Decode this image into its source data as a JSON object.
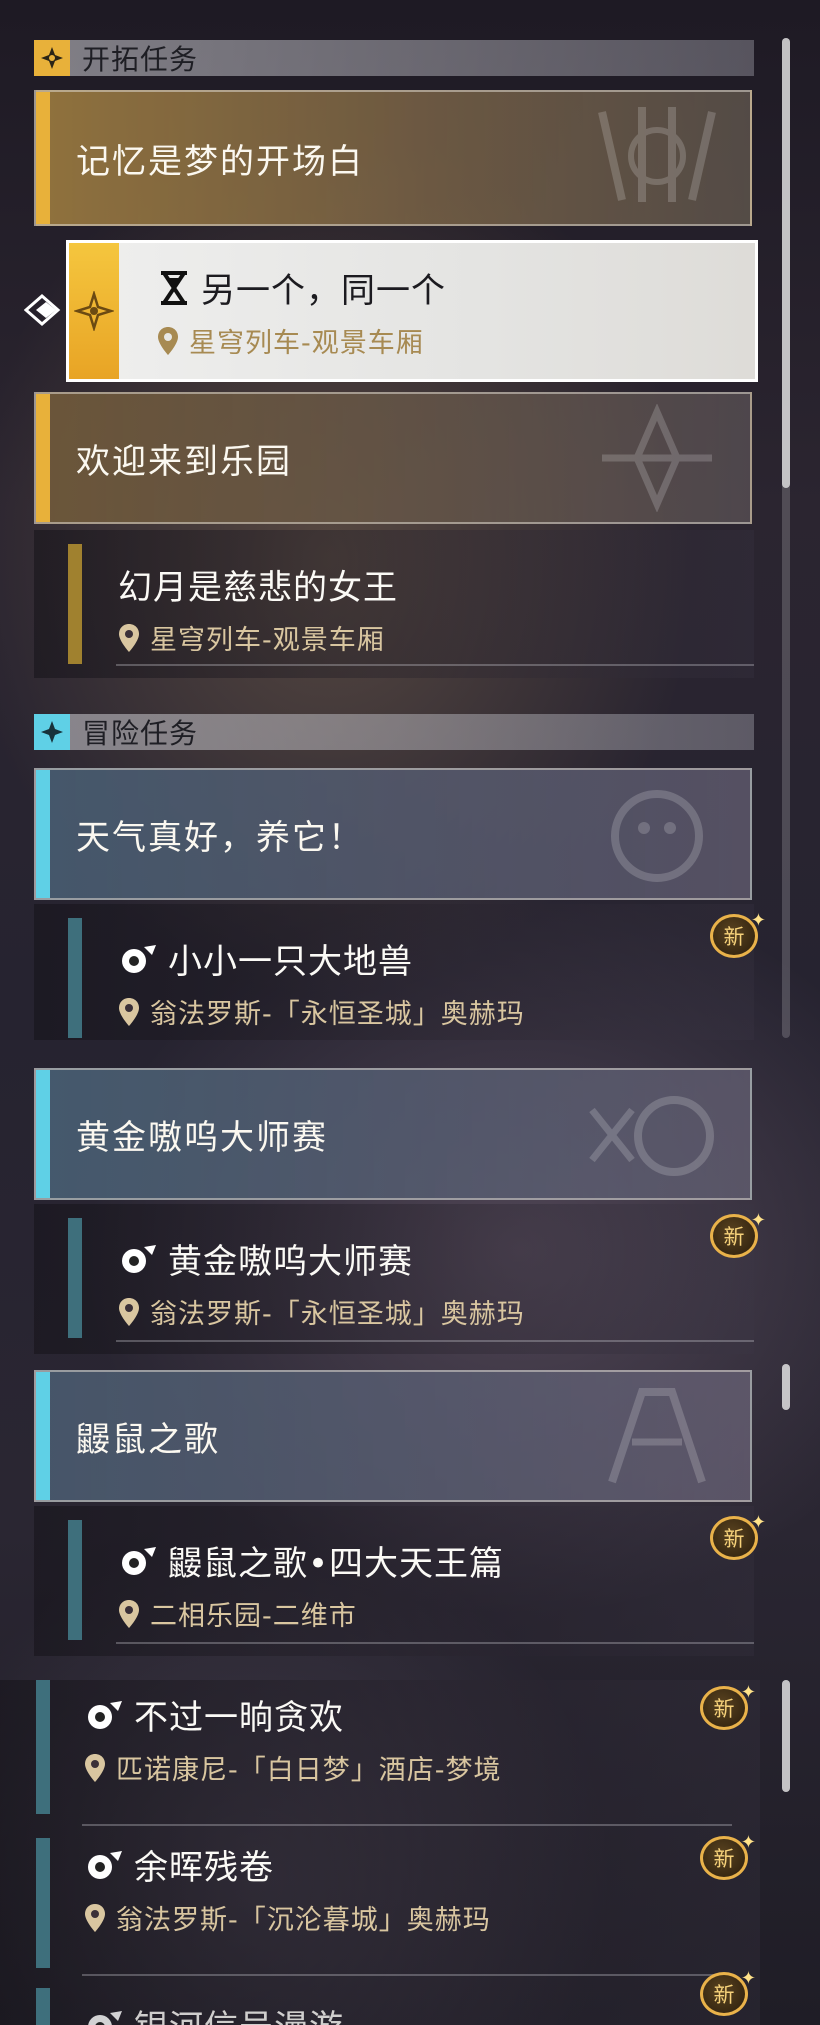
{
  "sections": {
    "trailblaze": {
      "title": "开拓任务"
    },
    "adventure": {
      "title": "冒险任务"
    }
  },
  "trailblaze": {
    "chapter1": {
      "title": "记忆是梦的开场白"
    },
    "selected_quest": {
      "name": "另一个，同一个",
      "location": "星穹列车-观景车厢"
    },
    "chapter2": {
      "title": "欢迎来到乐园"
    },
    "quest2": {
      "name": "幻月是慈悲的女王",
      "location": "星穹列车-观景车厢"
    }
  },
  "adventure": {
    "group1": {
      "title": "天气真好，养它！"
    },
    "quest1": {
      "name": "小小一只大地兽",
      "location": "翁法罗斯-「永恒圣城」奥赫玛"
    },
    "group2": {
      "title": "黄金嗷呜大师赛"
    },
    "quest2": {
      "name": "黄金嗷呜大师赛",
      "location": "翁法罗斯-「永恒圣城」奥赫玛"
    },
    "group3": {
      "title": "鼹鼠之歌"
    },
    "quest3": {
      "name": "鼹鼠之歌•四大天王篇",
      "location": "二相乐园-二维市"
    },
    "quest4": {
      "name": "不过一晌贪欢",
      "location": "匹诺康尼-「白日梦」酒店-梦境"
    },
    "quest5": {
      "name": "余晖残卷",
      "location": "翁法罗斯-「沉沦暮城」奥赫玛"
    },
    "quest6": {
      "name": "银河信号漫游"
    }
  },
  "badges": {
    "new_label": "新"
  },
  "colors": {
    "trailblaze_accent": "#e8b13a",
    "adventure_accent": "#5fd0e6",
    "location_text": "#d9c6a0",
    "new_badge_border": "#e9b24a"
  },
  "icons": {
    "trailblaze_section": "trailblaze-emblem-icon",
    "adventure_section": "adventure-star-icon",
    "selected_pointer": "selection-diamond-icon",
    "in_progress": "hourglass-icon",
    "adventure_quest": "adventure-quest-icon",
    "location": "map-pin-icon"
  }
}
